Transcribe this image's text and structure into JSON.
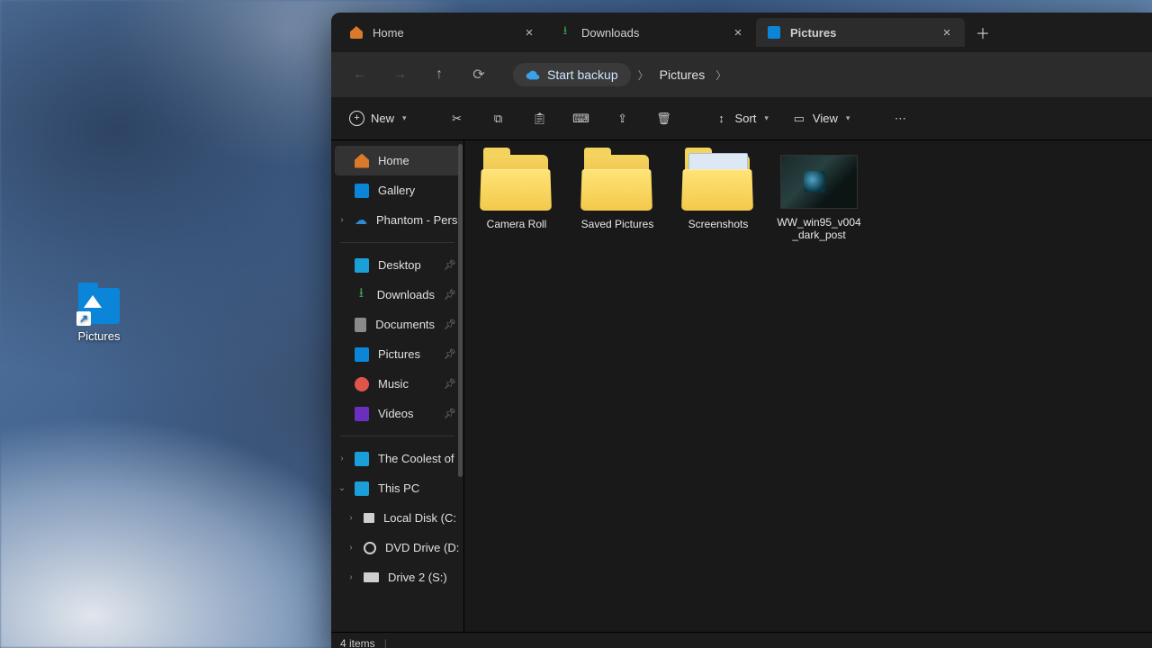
{
  "desktop": {
    "icon_label": "Pictures"
  },
  "tabs": [
    {
      "label": "Home",
      "icon": "home",
      "active": false
    },
    {
      "label": "Downloads",
      "icon": "download",
      "active": false
    },
    {
      "label": "Pictures",
      "icon": "picture",
      "active": true
    }
  ],
  "breadcrumb": {
    "start_backup": "Start backup",
    "current": "Pictures"
  },
  "toolbar": {
    "new_label": "New",
    "sort_label": "Sort",
    "view_label": "View"
  },
  "sidebar": {
    "home": "Home",
    "gallery": "Gallery",
    "phantom": "Phantom - Pers",
    "desktop": "Desktop",
    "downloads": "Downloads",
    "documents": "Documents",
    "pictures": "Pictures",
    "music": "Music",
    "videos": "Videos",
    "coolest": "The Coolest of",
    "this_pc": "This PC",
    "local_disk": "Local Disk (C:",
    "dvd_drive": "DVD Drive (D:",
    "drive2": "Drive 2 (S:)"
  },
  "content": {
    "items": [
      {
        "name": "Camera Roll",
        "type": "folder"
      },
      {
        "name": "Saved Pictures",
        "type": "folder"
      },
      {
        "name": "Screenshots",
        "type": "folder_peek"
      },
      {
        "name": "WW_win95_v004_dark_post",
        "type": "image"
      }
    ]
  },
  "statusbar": {
    "count": "4 items"
  }
}
